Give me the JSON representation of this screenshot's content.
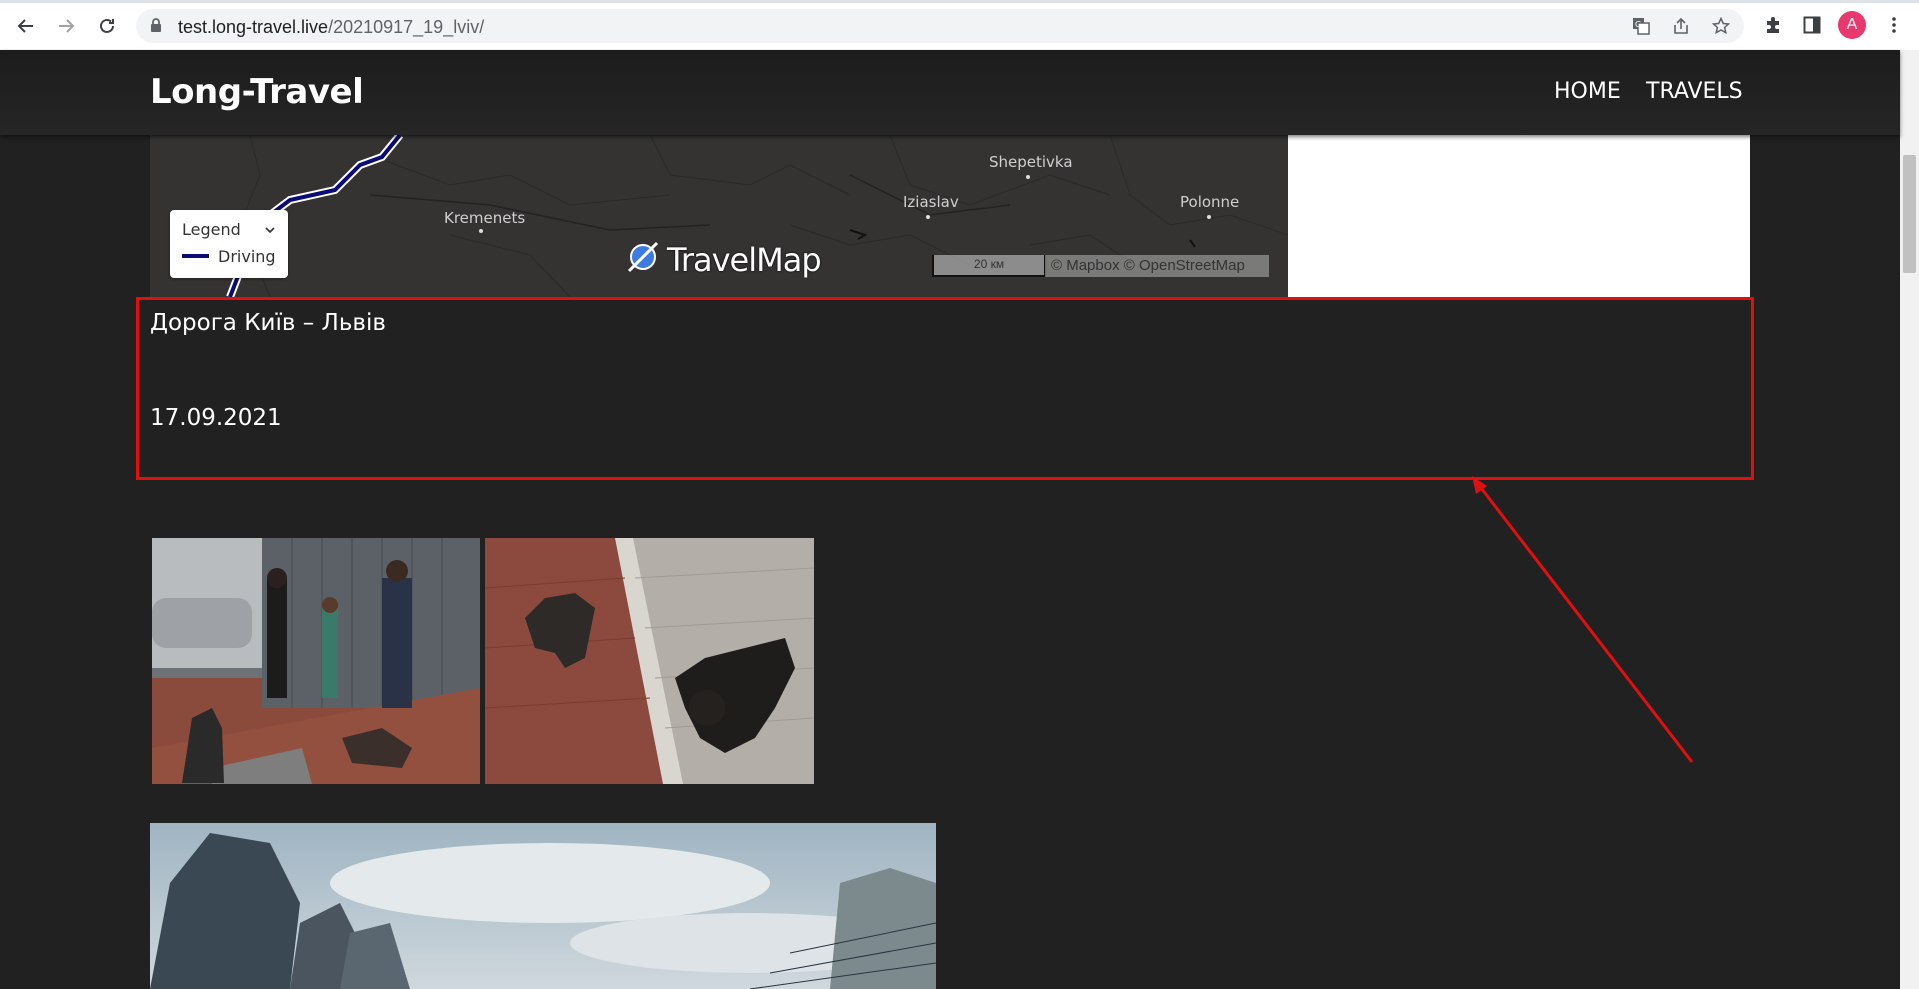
{
  "browser": {
    "url_host": "test.long-travel.live",
    "url_path": "/20210917_19_lviv/",
    "avatar_letter": "A",
    "icons": [
      "back-icon",
      "forward-icon",
      "reload-icon",
      "lock-icon",
      "translate-icon",
      "share-icon",
      "bookmark-star-icon",
      "extensions-icon",
      "side-panel-icon",
      "menu-icon"
    ]
  },
  "site": {
    "brand": "Long-Travel",
    "nav": [
      "HOME",
      "TRAVELS"
    ]
  },
  "map": {
    "cities": [
      "Shepetivka",
      "Iziaslav",
      "Polonne",
      "Kremenets"
    ],
    "legend_title": "Legend",
    "legend_item": "Driving",
    "legend_color": "#0a0a78",
    "logo_text": "TravelMap",
    "scale_label": "20 км",
    "attribution": "© Mapbox © OpenStreetMap"
  },
  "post": {
    "title": "Дорога Київ – Львів",
    "date": "17.09.2021"
  },
  "annotation_color": "#e01010"
}
